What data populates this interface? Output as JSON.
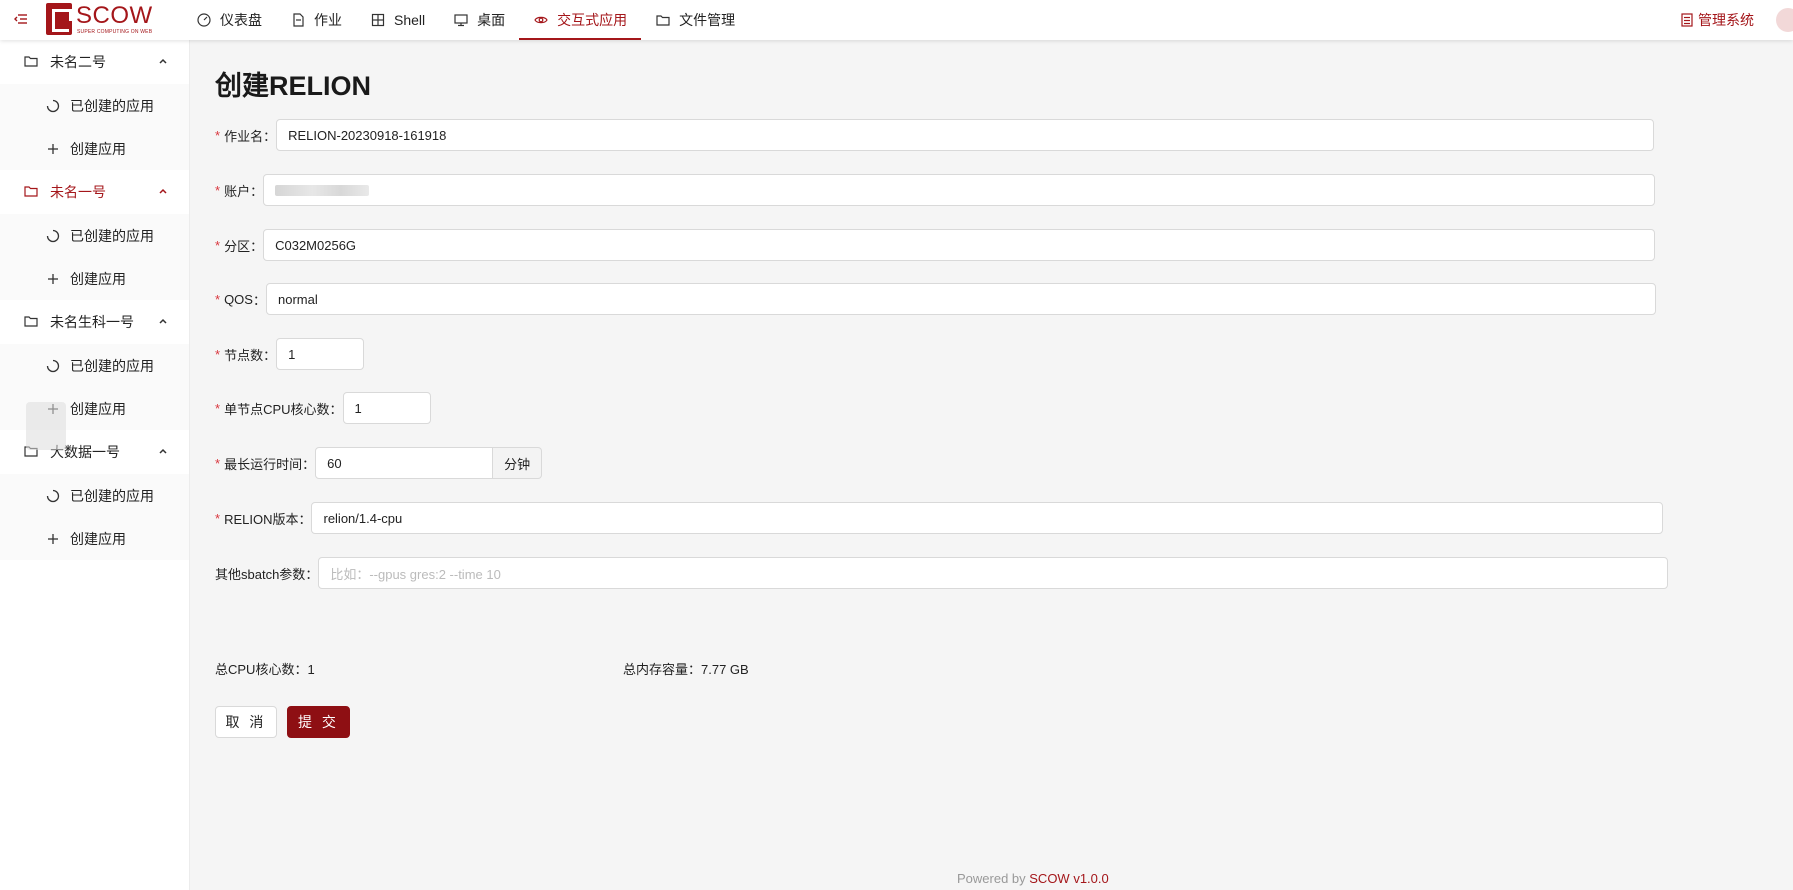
{
  "colors": {
    "primary": "#a4161a",
    "submit": "#8e0f13",
    "required": "#d9363e"
  },
  "header": {
    "menu_icon": "menu-fold-icon",
    "logo": {
      "text": "SCOW",
      "subtitle": "SUPER COMPUTING ON WEB"
    },
    "nav": [
      {
        "label": "仪表盘",
        "icon": "dashboard-icon"
      },
      {
        "label": "作业",
        "icon": "file-icon"
      },
      {
        "label": "Shell",
        "icon": "terminal-icon"
      },
      {
        "label": "桌面",
        "icon": "desktop-icon"
      },
      {
        "label": "交互式应用",
        "icon": "eye-icon",
        "active": true
      },
      {
        "label": "文件管理",
        "icon": "folder-icon"
      }
    ],
    "admin_label": "管理系统"
  },
  "sidebar": {
    "groups": [
      {
        "title": "未名二号",
        "items": [
          "已创建的应用",
          "创建应用"
        ]
      },
      {
        "title": "未名一号",
        "active": true,
        "items": [
          "已创建的应用",
          "创建应用"
        ]
      },
      {
        "title": "未名生科一号",
        "items": [
          "已创建的应用",
          "创建应用"
        ]
      },
      {
        "title": "大数据一号",
        "items": [
          "已创建的应用",
          "创建应用"
        ]
      }
    ]
  },
  "form": {
    "title": "创建RELION",
    "fields": {
      "job_name": {
        "label": "作业名",
        "value": "RELION-20230918-161918"
      },
      "account": {
        "label": "账户",
        "value": ""
      },
      "partition": {
        "label": "分区",
        "value": "C032M0256G"
      },
      "qos": {
        "label": "QOS",
        "value": "normal"
      },
      "nodes": {
        "label": "节点数",
        "value": "1"
      },
      "cores": {
        "label": "单节点CPU核心数",
        "value": "1"
      },
      "max_time": {
        "label": "最长运行时间",
        "value": "60",
        "unit": "分钟"
      },
      "version": {
        "label": "RELION版本",
        "value": "relion/1.4-cpu"
      },
      "sbatch": {
        "label": "其他sbatch参数",
        "placeholder": "比如：--gpus gres:2 --time 10"
      }
    },
    "summary": {
      "cpu_label": "总CPU核心数：",
      "cpu_value": "1",
      "mem_label": "总内存容量：",
      "mem_value": "7.77 GB"
    },
    "buttons": {
      "cancel": "取 消",
      "submit": "提 交"
    }
  },
  "footer": {
    "prefix": "Powered by ",
    "brand": "SCOW v1.0.0"
  }
}
